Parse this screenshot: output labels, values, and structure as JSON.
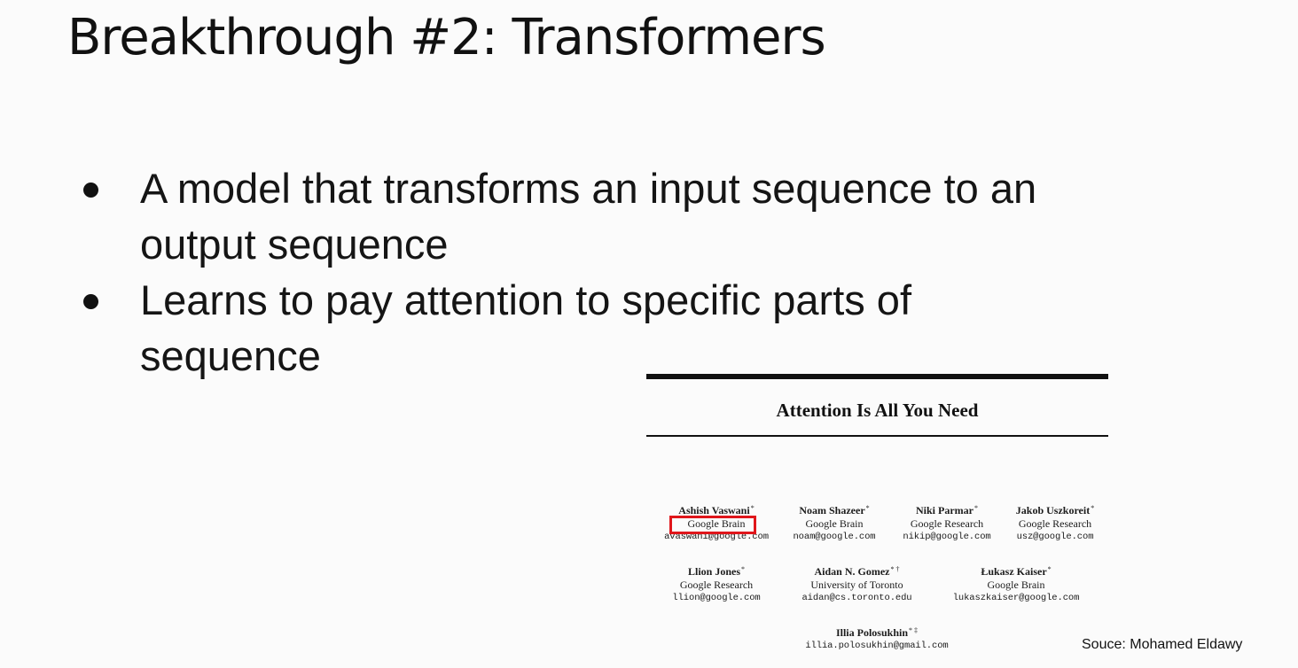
{
  "slide": {
    "title": "Breakthrough #2: Transformers",
    "bullets": [
      {
        "line1": "A model that transforms an input sequence to an",
        "line2": "output sequence"
      },
      {
        "line1": "Learns to pay attention to specific parts of",
        "line2": "sequence"
      }
    ],
    "source": "Souce: Mohamed Eldawy"
  },
  "paper": {
    "title": "Attention Is All You Need",
    "authors": [
      {
        "name": "Ashish Vaswani",
        "mark": "*",
        "affiliation": "Google Brain",
        "email": "avaswani@google.com"
      },
      {
        "name": "Noam Shazeer",
        "mark": "*",
        "affiliation": "Google Brain",
        "email": "noam@google.com"
      },
      {
        "name": "Niki Parmar",
        "mark": "*",
        "affiliation": "Google Research",
        "email": "nikip@google.com"
      },
      {
        "name": "Jakob Uszkoreit",
        "mark": "*",
        "affiliation": "Google Research",
        "email": "usz@google.com"
      },
      {
        "name": "Llion Jones",
        "mark": "*",
        "affiliation": "Google Research",
        "email": "llion@google.com"
      },
      {
        "name": "Aidan N. Gomez",
        "mark": "* †",
        "affiliation": "University of Toronto",
        "email": "aidan@cs.toronto.edu"
      },
      {
        "name": "Łukasz Kaiser",
        "mark": "*",
        "affiliation": "Google Brain",
        "email": "lukaszkaiser@google.com"
      },
      {
        "name": "Illia Polosukhin",
        "mark": "* ‡",
        "email": "illia.polosukhin@gmail.com"
      }
    ],
    "highlight_color": "#e0161b"
  }
}
